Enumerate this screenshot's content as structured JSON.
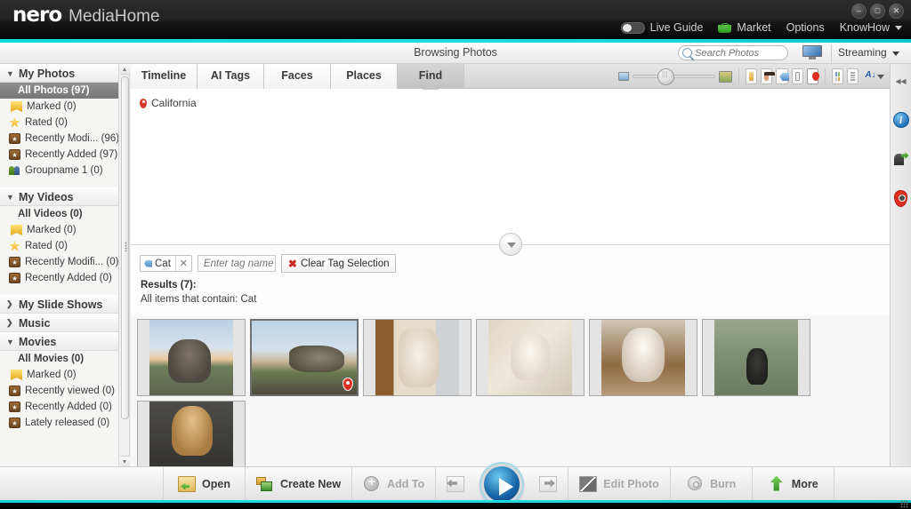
{
  "window": {
    "brand": "nero",
    "app_name": "MediaHome",
    "minimize": "–",
    "maximize": "□",
    "close": "✕"
  },
  "topnav": {
    "live_guide": "Live Guide",
    "market": "Market",
    "options": "Options",
    "knowhow": "KnowHow"
  },
  "header": {
    "title": "Browsing Photos",
    "streaming": "Streaming"
  },
  "search": {
    "placeholder": "Search Photos",
    "value": ""
  },
  "sidebar": {
    "groups": [
      {
        "title": "My Photos",
        "expanded": true,
        "items": [
          {
            "label": "All Photos (97)",
            "icon": "none",
            "selected": true,
            "top": true
          },
          {
            "label": "Marked (0)",
            "icon": "marked-icon"
          },
          {
            "label": "Rated (0)",
            "icon": "star-icon"
          },
          {
            "label": "Recently Modi... (96)",
            "icon": "recent-icon"
          },
          {
            "label": "Recently Added (97)",
            "icon": "recent-icon"
          },
          {
            "label": "Groupname 1 (0)",
            "icon": "group-icon"
          }
        ]
      },
      {
        "title": "My Videos",
        "expanded": true,
        "items": [
          {
            "label": "All Videos (0)",
            "icon": "none",
            "top": true
          },
          {
            "label": "Marked (0)",
            "icon": "marked-icon"
          },
          {
            "label": "Rated (0)",
            "icon": "star-icon"
          },
          {
            "label": "Recently Modifi... (0)",
            "icon": "recent-icon"
          },
          {
            "label": "Recently Added (0)",
            "icon": "recent-icon"
          }
        ]
      },
      {
        "title": "My Slide Shows",
        "expanded": false,
        "items": []
      },
      {
        "title": "Music",
        "expanded": false,
        "items": []
      },
      {
        "title": "Movies",
        "expanded": true,
        "items": [
          {
            "label": "All Movies (0)",
            "icon": "none",
            "top": true
          },
          {
            "label": "Marked (0)",
            "icon": "marked-icon"
          },
          {
            "label": "Recently viewed (0)",
            "icon": "recent-icon"
          },
          {
            "label": "Recently Added (0)",
            "icon": "recent-icon"
          },
          {
            "label": "Lately released (0)",
            "icon": "recent-icon"
          }
        ]
      }
    ]
  },
  "tabs": [
    {
      "label": "Timeline",
      "active": false
    },
    {
      "label": "AI Tags",
      "active": false
    },
    {
      "label": "Faces",
      "active": false
    },
    {
      "label": "Places",
      "active": false
    },
    {
      "label": "Find",
      "active": true
    }
  ],
  "map_pane": {
    "place_label": "California"
  },
  "filter": {
    "tag_chip": "Cat",
    "tag_chip_remove": "✕",
    "tag_input_placeholder": "Enter tag name",
    "tag_input_value": "",
    "clear_label": "Clear Tag Selection",
    "clear_mark": "✖",
    "results_heading": "Results (7):",
    "results_sub": "All items that contain: Cat"
  },
  "thumbnails": [
    {
      "name": "tabby-cat-on-wall",
      "selected": false,
      "geotagged": false
    },
    {
      "name": "tabby-cat-walking",
      "selected": true,
      "geotagged": true
    },
    {
      "name": "fluffy-cat-in-box",
      "selected": false,
      "geotagged": false
    },
    {
      "name": "white-kitten-on-tile",
      "selected": false,
      "geotagged": false
    },
    {
      "name": "siamese-kitten",
      "selected": false,
      "geotagged": false
    },
    {
      "name": "black-cat-on-grass",
      "selected": false,
      "geotagged": false
    },
    {
      "name": "ginger-cat-drinking",
      "selected": false,
      "geotagged": false
    }
  ],
  "toolbar": {
    "zoom_value": 30,
    "filters": [
      "folder-filter",
      "faces-filter",
      "tags-filter",
      "details-filter",
      "geotag-filter"
    ],
    "views": [
      "grid-view",
      "list-view"
    ],
    "sort": "sort-az"
  },
  "bottombar": {
    "items": [
      {
        "label": "Open",
        "icon": "open-icon",
        "disabled": false
      },
      {
        "label": "Create New",
        "icon": "create-new-icon",
        "disabled": false
      },
      {
        "label": "Add To",
        "icon": "add-to-icon",
        "disabled": true
      },
      {
        "label": "Edit Photo",
        "icon": "edit-photo-icon",
        "disabled": true
      },
      {
        "label": "Burn",
        "icon": "burn-icon",
        "disabled": true
      },
      {
        "label": "More",
        "icon": "more-icon",
        "disabled": false
      }
    ]
  },
  "rightrail": {
    "collapse": "◂◂",
    "info": "i"
  }
}
